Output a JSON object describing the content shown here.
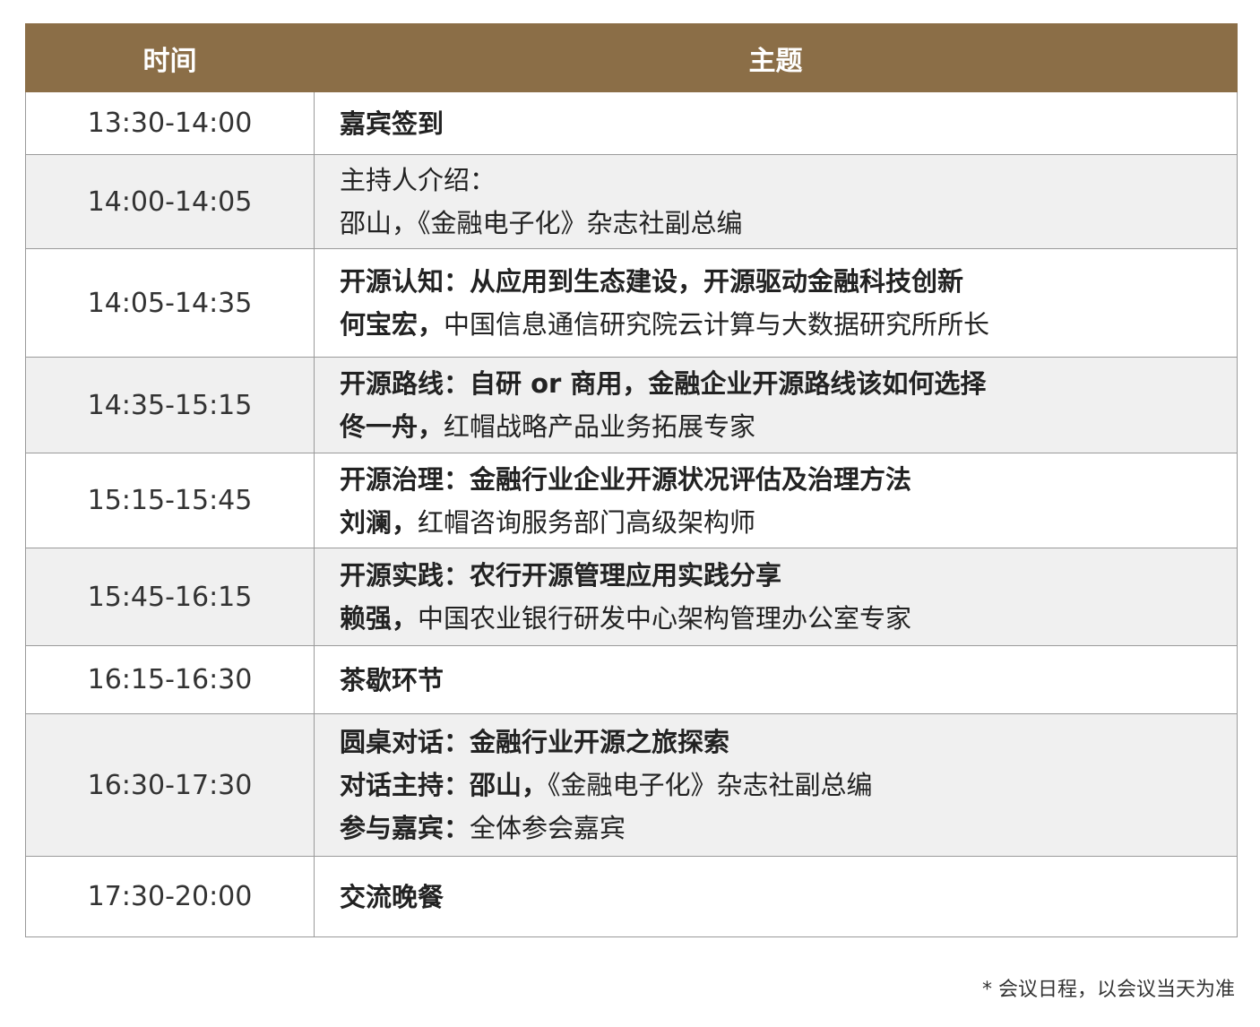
{
  "header": {
    "time": "时间",
    "topic": "主题"
  },
  "rows": [
    {
      "time": "13:30-14:00",
      "lines": [
        {
          "strong": "嘉宾签到",
          "rest": ""
        }
      ]
    },
    {
      "time": "14:00-14:05",
      "lines": [
        {
          "strong": "",
          "rest": "主持人介绍："
        },
        {
          "strong": "",
          "rest": "邵山，《金融电子化》杂志社副总编"
        }
      ]
    },
    {
      "time": "14:05-14:35",
      "lines": [
        {
          "strong": "开源认知：从应用到生态建设，开源驱动金融科技创新",
          "rest": ""
        },
        {
          "strong": "何宝宏，",
          "rest": "中国信息通信研究院云计算与大数据研究所所长"
        }
      ]
    },
    {
      "time": "14:35-15:15",
      "lines": [
        {
          "strong": "开源路线：自研 or 商用，金融企业开源路线该如何选择",
          "rest": ""
        },
        {
          "strong": "佟一舟，",
          "rest": "红帽战略产品业务拓展专家"
        }
      ]
    },
    {
      "time": "15:15-15:45",
      "lines": [
        {
          "strong": "开源治理：金融行业企业开源状况评估及治理方法",
          "rest": ""
        },
        {
          "strong": "刘澜，",
          "rest": "红帽咨询服务部门高级架构师"
        }
      ]
    },
    {
      "time": "15:45-16:15",
      "lines": [
        {
          "strong": "开源实践：农行开源管理应用实践分享",
          "rest": ""
        },
        {
          "strong": "赖强，",
          "rest": "中国农业银行研发中心架构管理办公室专家"
        }
      ]
    },
    {
      "time": "16:15-16:30",
      "lines": [
        {
          "strong": "茶歇环节",
          "rest": ""
        }
      ]
    },
    {
      "time": "16:30-17:30",
      "lines": [
        {
          "strong": "圆桌对话：金融行业开源之旅探索",
          "rest": ""
        },
        {
          "strong": "对话主持：邵山，",
          "rest": "《金融电子化》杂志社副总编"
        },
        {
          "strong": "参与嘉宾：",
          "rest": "全体参会嘉宾"
        }
      ]
    },
    {
      "time": "17:30-20:00",
      "lines": [
        {
          "strong": "交流晚餐",
          "rest": ""
        }
      ]
    }
  ],
  "footnote": "* 会议日程，以会议当天为准",
  "colors": {
    "header_bg": "#8b6e47",
    "row_shade": "#f0f0f0",
    "border": "#9a9a9a"
  }
}
